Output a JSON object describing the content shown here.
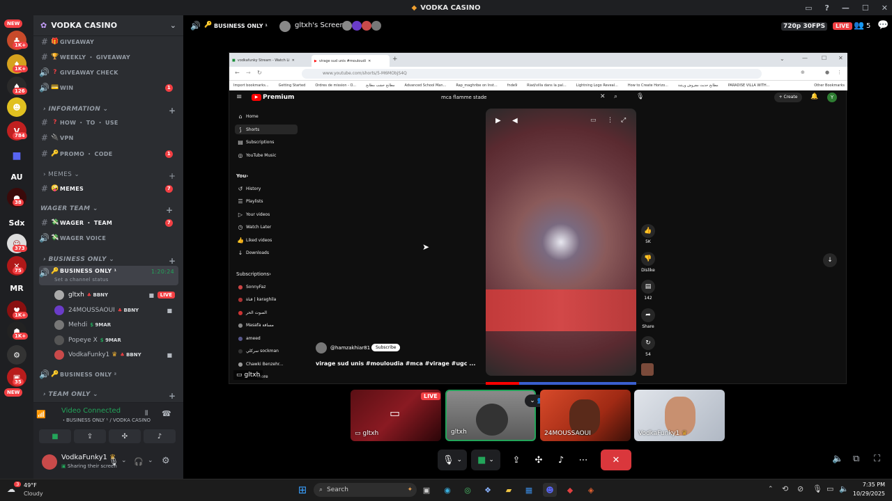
{
  "app": {
    "title": "VODKA CASINO"
  },
  "rail": {
    "new_top": "NEW",
    "new_bottom": "NEW",
    "badges": [
      "1K+",
      "1K+",
      "126",
      "784",
      "38",
      "373",
      "75",
      "1K+",
      "1K+",
      "35"
    ],
    "text_servers": [
      "AU",
      "Sdx",
      "MR"
    ]
  },
  "sidebar": {
    "server_name": "VODKA CASINO",
    "channels": [
      {
        "name": "GIVEAWAY",
        "emoji": "🎁"
      },
      {
        "name": "WEEKLY ・ GIVEAWAY",
        "emoji": "🏆"
      },
      {
        "name": "GIVEAWAY CHECK",
        "emoji": "❓"
      },
      {
        "name": "WIN",
        "emoji": "💳",
        "badge": "1"
      }
    ],
    "cat_information": "INFORMATION",
    "info_channels": [
      {
        "name": "HOW ・ TO ・ USE",
        "emoji": "❓"
      },
      {
        "name": "VPN",
        "emoji": "🔌"
      },
      {
        "name": "PROMO ・ CODE",
        "emoji": "🔑",
        "badge": "1"
      }
    ],
    "cat_memes": "MEMES",
    "memes_channels": [
      {
        "name": "MEMES",
        "emoji": "🤪",
        "badge": "7"
      }
    ],
    "cat_wager": "WAGER TEAM",
    "wager_channels": [
      {
        "name": "WAGER ・ TEAM",
        "emoji": "💸",
        "badge": "7"
      },
      {
        "name": "WAGER VOICE",
        "emoji": "💸"
      }
    ],
    "cat_business": "BUSINESS ONLY",
    "business_voice": {
      "name": "BUSINESS ONLY ¹",
      "emoji": "🔑",
      "timer": "1:20:24",
      "status": "Set a channel status"
    },
    "voice_users": [
      {
        "name": "gltxh",
        "tag": "BBNY",
        "tagcolor": "#f23f43",
        "live": "LIVE"
      },
      {
        "name": "24MOUSSAOUI",
        "tag": "BBNY",
        "tagcolor": "#f23f43"
      },
      {
        "name": "Mehdi",
        "tag": "9MAR",
        "tagcolor": "#23a55a"
      },
      {
        "name": "Popeye X",
        "tag": "9MAR",
        "tagcolor": "#23a55a"
      },
      {
        "name": "VodkaFunky1",
        "tag": "BBNY",
        "tagcolor": "#f23f43"
      }
    ],
    "business_voice2": "BUSINESS ONLY ²",
    "cat_team": "TEAM ONLY"
  },
  "voicepanel": {
    "status": "Video Connected",
    "channel": "・BUSINESS ONLY ¹ / VODKA CASINO",
    "username": "VodkaFunky1",
    "substatus": "Sharing their screen"
  },
  "stage": {
    "channel": "BUSINESS ONLY ¹",
    "screen_title": "gltxh's Screen",
    "quality": "720p 30FPS",
    "live": "LIVE",
    "participants": "5",
    "share_label": "gltxh"
  },
  "youtube": {
    "tab1": "vodkafunky Stream - Watch Li",
    "tab2": "virage sud unis #mouloudi",
    "url": "www.youtube.com/shorts/5-M6MObjS4Q",
    "bookmarks": [
      "Import bookmarks...",
      "Getting Started",
      "Ordres de mission - O...",
      "مطابخ خشب مطابخ",
      "Advanced School Man...",
      "Rap_maghribe on Inst...",
      "fnde9",
      "Riad/villa dans la pal...",
      "Lightning Logo Reveal...",
      "How to Create Horizo...",
      "مطابخ حديث مفروش ورشة",
      "PARADISE VILLA WITH...",
      "Other Bookmarks"
    ],
    "logo": "Premium",
    "search": "mca flamme stade",
    "create": "Create",
    "nav": [
      "Home",
      "Shorts",
      "Subscriptions",
      "YouTube Music"
    ],
    "you": "You",
    "you_items": [
      "History",
      "Playlists",
      "Your videos",
      "Watch Later",
      "Liked videos",
      "Downloads"
    ],
    "subs_title": "Subscriptions",
    "subs": [
      "SonnyFaz",
      "قناة | karaghila",
      "الصوت الحر",
      "Masafa مسافة",
      "ameed",
      "سركلي sockman",
      "Chawki Benzehr..."
    ],
    "show_more": "more",
    "channel": "@hamzakhiar81",
    "subscribe": "Subscribe",
    "video_title": "virage sud unis #mouloudia #mca #virage #ugc ...",
    "likes": "5K",
    "dislike": "Dislike",
    "comments": "142",
    "share": "Share",
    "remix": "54"
  },
  "tiles": [
    {
      "name": "gltxh",
      "live": "LIVE"
    },
    {
      "name": "gltxh"
    },
    {
      "name": "24MOUSSAOUI"
    },
    {
      "name": "VodkaFunky1"
    }
  ],
  "taskbar": {
    "weather_temp": "49°F",
    "weather_desc": "Cloudy",
    "weather_badge": "3",
    "search": "Search",
    "time": "7:35 PM",
    "date": "10/29/2025"
  }
}
